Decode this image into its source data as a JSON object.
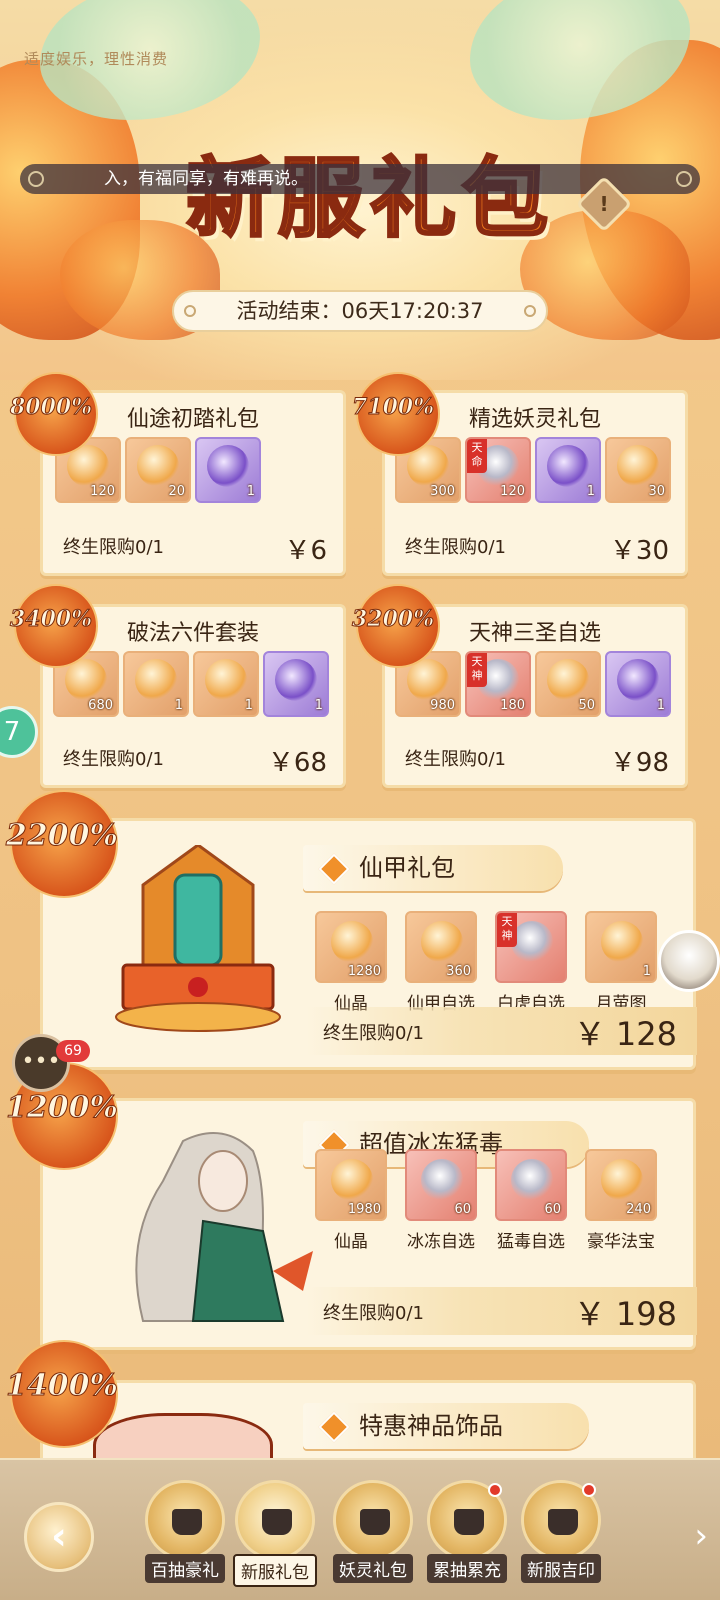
{
  "header": {
    "disclaimer": "适度娱乐，理性消费",
    "marquee_text": "入，有福同享，有难再说。",
    "title": "新服礼包",
    "timer_label": "活动结束：06天17:20:37"
  },
  "small_packs": [
    {
      "badge": "8000%",
      "title": "仙途初踏礼包",
      "items": [
        {
          "qty": "120",
          "style": "orange"
        },
        {
          "qty": "20",
          "style": "orange"
        },
        {
          "qty": "1",
          "style": "purple"
        }
      ],
      "limit": "终生限购0/1",
      "price": "￥6"
    },
    {
      "badge": "7100%",
      "title": "精选妖灵礼包",
      "items": [
        {
          "qty": "300",
          "style": "orange"
        },
        {
          "qty": "120",
          "style": "red",
          "tag": "天命"
        },
        {
          "qty": "1",
          "style": "purple"
        },
        {
          "qty": "30",
          "style": "orange"
        }
      ],
      "limit": "终生限购0/1",
      "price": "￥30"
    },
    {
      "badge": "3400%",
      "title": "破法六件套装",
      "items": [
        {
          "qty": "680",
          "style": "orange"
        },
        {
          "qty": "1",
          "style": "orange"
        },
        {
          "qty": "1",
          "style": "orange"
        },
        {
          "qty": "1",
          "style": "purple"
        }
      ],
      "limit": "终生限购0/1",
      "price": "￥68"
    },
    {
      "badge": "3200%",
      "title": "天神三圣自选",
      "items": [
        {
          "qty": "980",
          "style": "orange"
        },
        {
          "qty": "180",
          "style": "red",
          "tag": "天神"
        },
        {
          "qty": "50",
          "style": "orange"
        },
        {
          "qty": "1",
          "style": "purple"
        }
      ],
      "limit": "终生限购0/1",
      "price": "￥98"
    }
  ],
  "big_packs": [
    {
      "badge": "2200%",
      "title": "仙甲礼包",
      "items": [
        {
          "qty": "1280",
          "label": "仙晶",
          "style": "orange"
        },
        {
          "qty": "360",
          "label": "仙甲自选",
          "style": "orange"
        },
        {
          "qty": "",
          "label": "白虎自选",
          "style": "red",
          "tag": "天神"
        },
        {
          "qty": "1",
          "label": "月萤图",
          "style": "orange"
        }
      ],
      "limit": "终生限购0/1",
      "price": "￥ 128"
    },
    {
      "badge": "1200%",
      "title": "超值冰冻猛毒",
      "items": [
        {
          "qty": "1980",
          "label": "仙晶",
          "style": "orange"
        },
        {
          "qty": "60",
          "label": "冰冻自选",
          "style": "red"
        },
        {
          "qty": "60",
          "label": "猛毒自选",
          "style": "red"
        },
        {
          "qty": "240",
          "label": "豪华法宝",
          "style": "orange"
        }
      ],
      "limit": "终生限购0/1",
      "price": "￥ 198"
    },
    {
      "badge": "1400%",
      "title": "特惠神品饰品"
    }
  ],
  "floating": {
    "chat_count": "69",
    "side_label": "7"
  },
  "bottom_nav": [
    {
      "label": "百抽豪礼",
      "active": false,
      "dot": false
    },
    {
      "label": "新服礼包",
      "active": true,
      "dot": false
    },
    {
      "label": "妖灵礼包",
      "active": false,
      "dot": false
    },
    {
      "label": "累抽累充",
      "active": false,
      "dot": true
    },
    {
      "label": "新服吉印",
      "active": false,
      "dot": true
    }
  ]
}
